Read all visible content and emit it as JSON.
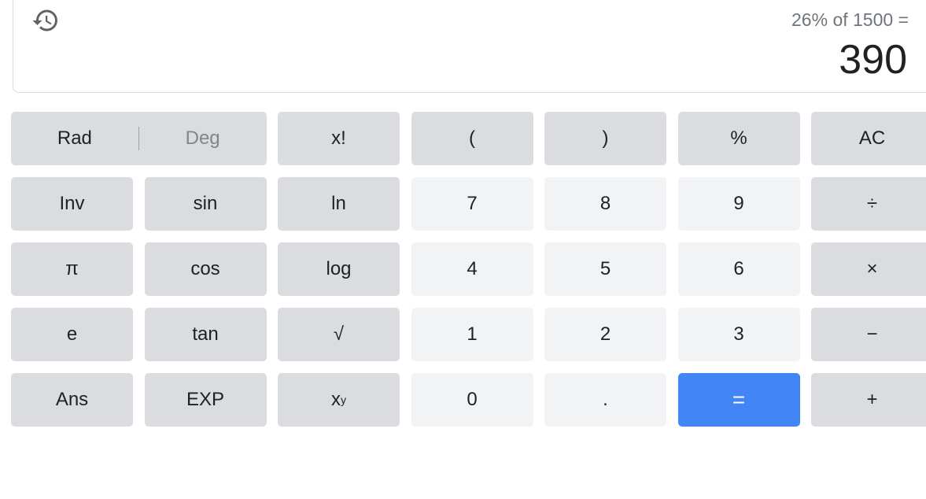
{
  "display": {
    "history_icon": "history-icon",
    "expression": "26% of 1500 =",
    "result": "390"
  },
  "keys": {
    "rad": "Rad",
    "deg": "Deg",
    "factorial": "x!",
    "open_paren": "(",
    "close_paren": ")",
    "percent": "%",
    "clear": "AC",
    "inv": "Inv",
    "sin": "sin",
    "ln": "ln",
    "seven": "7",
    "eight": "8",
    "nine": "9",
    "divide": "÷",
    "pi": "π",
    "cos": "cos",
    "log": "log",
    "four": "4",
    "five": "5",
    "six": "6",
    "multiply": "×",
    "e": "e",
    "tan": "tan",
    "sqrt": "√",
    "one": "1",
    "two": "2",
    "three": "3",
    "minus": "−",
    "ans": "Ans",
    "exp": "EXP",
    "power_base": "x",
    "power_exp": "y",
    "zero": "0",
    "dot": ".",
    "equals": "=",
    "plus": "+"
  },
  "colors": {
    "function_key_bg": "#dadce0",
    "number_key_bg": "#f1f3f4",
    "equals_key_bg": "#4285f4"
  }
}
